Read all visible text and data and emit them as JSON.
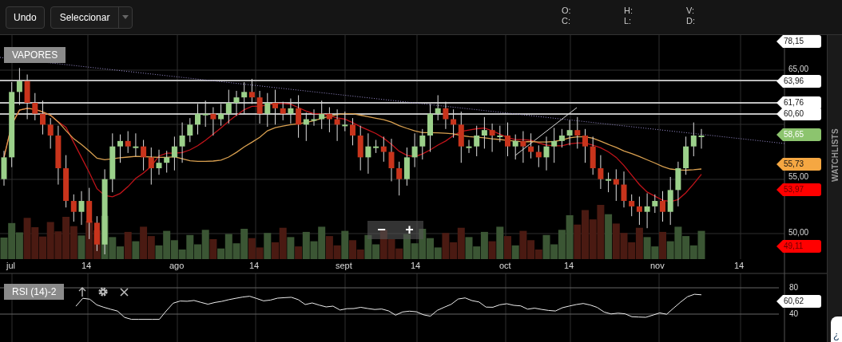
{
  "toolbar": {
    "undo": "Undo",
    "select": "Seleccionar"
  },
  "ohlc": [
    {
      "label": "O:"
    },
    {
      "label": "H:"
    },
    {
      "label": "V:"
    },
    {
      "label": "C:"
    },
    {
      "label": "L:"
    },
    {
      "label": "D:"
    }
  ],
  "chart": {
    "symbol": "VAPORES",
    "price_axis": [
      "65,00",
      "55,00",
      "50,00"
    ],
    "price_tags": [
      {
        "text": "78,15",
        "color": "#ffffff"
      },
      {
        "text": "63,96",
        "color": "#ffffff"
      },
      {
        "text": "61,76",
        "color": "#ffffff"
      },
      {
        "text": "60,60",
        "color": "#ffffff"
      },
      {
        "text": "58,65",
        "color": "#8cc46e"
      },
      {
        "text": "55,73",
        "color": "#f5a742"
      },
      {
        "text": "53,97",
        "color": "#ff0000"
      },
      {
        "text": "49,11",
        "color": "#ff0000"
      }
    ],
    "zoom_controls": [
      "−",
      "+"
    ],
    "x_axis": [
      "jul",
      "14",
      "ago",
      "14",
      "sept",
      "14",
      "oct",
      "14",
      "nov",
      "14"
    ]
  },
  "rsi": {
    "label": "RSI (14)-2",
    "axis": [
      "80",
      "40"
    ],
    "tag": "60,62"
  },
  "sidebar": {
    "label": "WATCHLISTS"
  },
  "help_widget": {
    "text": "¿"
  }
}
